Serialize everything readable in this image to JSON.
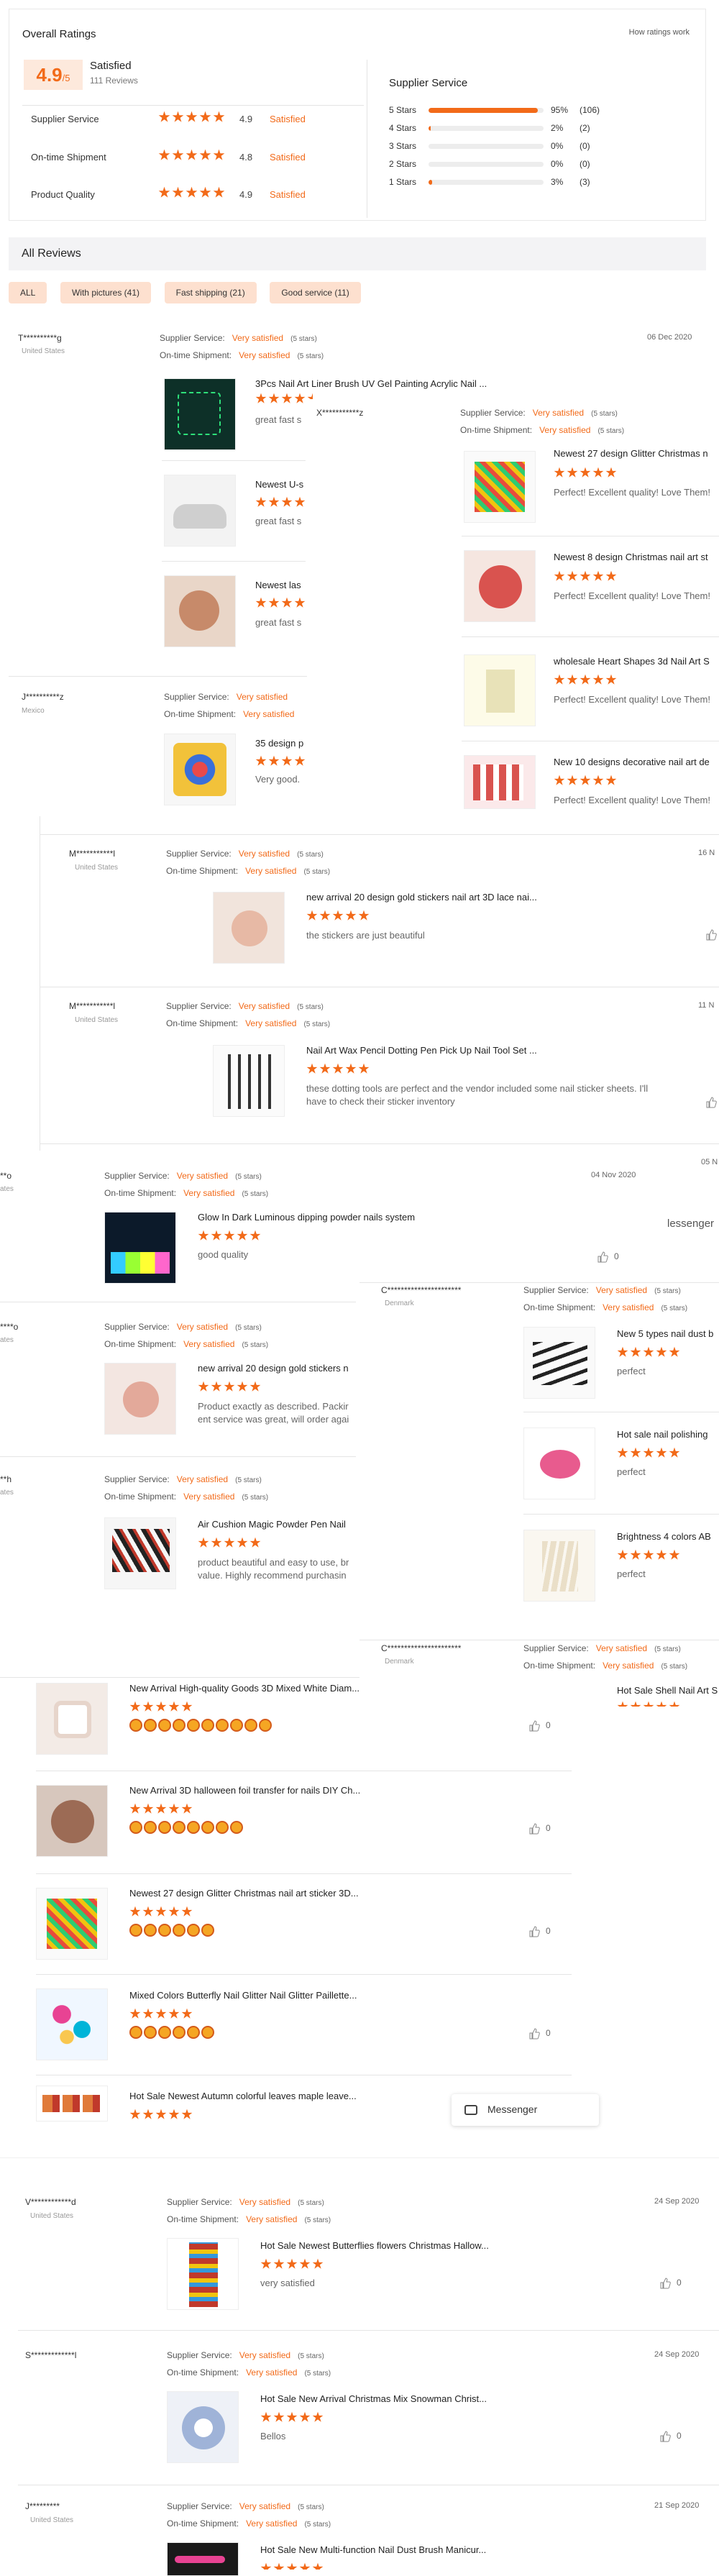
{
  "overall": {
    "title": "Overall Ratings",
    "how_link": "How ratings work",
    "score": "4.9",
    "score_suffix": "/5",
    "label": "Satisfied",
    "count": "111 Reviews",
    "metrics": [
      {
        "name": "Supplier Service",
        "score": "4.9",
        "level": "Satisfied"
      },
      {
        "name": "On-time Shipment",
        "score": "4.8",
        "level": "Satisfied"
      },
      {
        "name": "Product Quality",
        "score": "4.9",
        "level": "Satisfied"
      }
    ],
    "supplier_service_title": "Supplier Service",
    "distribution": [
      {
        "label": "5 Stars",
        "pct": "95%",
        "count": "(106)",
        "fraction": 0.95
      },
      {
        "label": "4 Stars",
        "pct": "2%",
        "count": "(2)",
        "fraction": 0.02
      },
      {
        "label": "3 Stars",
        "pct": "0%",
        "count": "(0)",
        "fraction": 0
      },
      {
        "label": "2 Stars",
        "pct": "0%",
        "count": "(0)",
        "fraction": 0
      },
      {
        "label": "1 Stars",
        "pct": "3%",
        "count": "(3)",
        "fraction": 0.03
      }
    ]
  },
  "all_reviews": {
    "title": "All Reviews",
    "filters": [
      "ALL",
      "With pictures (41)",
      "Fast shipping (21)",
      "Good service (11)"
    ]
  },
  "labels": {
    "supplier_service": "Supplier Service:",
    "on_time": "On-time Shipment:",
    "very_satisfied": "Very satisfied",
    "five_stars": "(5 stars)"
  },
  "reviews_a": {
    "r1": {
      "name": "T**********g",
      "country": "United States",
      "date": "06 Dec 2020",
      "items": [
        {
          "product": "3Pcs Nail Art Liner Brush UV Gel Painting Acrylic Nail ...",
          "text": "great fast s"
        },
        {
          "product": "Newest U-s",
          "text": "great fast s"
        },
        {
          "product": "Newest las",
          "text": "great fast s"
        }
      ]
    },
    "r2": {
      "name": "J**********z",
      "country": "Mexico",
      "items": [
        {
          "product": "35 design p",
          "text": "Very good."
        }
      ]
    },
    "r_overlay": {
      "name": "X***********z",
      "items": [
        {
          "product": "Newest 27 design Glitter Christmas n",
          "text": "Perfect! Excellent quality! Love Them!"
        },
        {
          "product": "Newest 8 design Christmas nail art st",
          "text": "Perfect! Excellent quality! Love Them!"
        },
        {
          "product": "wholesale Heart Shapes 3d Nail Art S",
          "text": "Perfect! Excellent quality! Love Them!"
        },
        {
          "product": "New 10 designs decorative nail art de",
          "text": "Perfect! Excellent quality! Love Them!"
        }
      ]
    },
    "r3": {
      "name": "M***********l",
      "country": "United States",
      "date": "16 N",
      "product": "new arrival 20 design gold stickers nail art 3D lace nai...",
      "text": "the stickers are just beautiful"
    },
    "r4": {
      "name": "M***********l",
      "country": "United States",
      "date": "11 N",
      "product": "Nail Art Wax Pencil Dotting Pen Pick Up Nail Tool Set ...",
      "text": "these dotting tools are perfect and the vendor included some nail sticker sheets. I'll have to check their sticker inventory"
    }
  },
  "reviews_b": {
    "r5": {
      "name": "**o",
      "country": "ates",
      "date": "04 Nov 2020",
      "date2": "05 N",
      "product": "Glow In Dark Luminous dipping powder nails system",
      "text": "good quality",
      "likes": "0"
    },
    "messenger_partial": "lessenger",
    "r6": {
      "name": "****o",
      "country": "ates",
      "product": "new arrival 20 design gold stickers n",
      "text": "Product exactly as described. Packir ent service was great, will order agai"
    },
    "r7": {
      "name": "**h",
      "country": "ates",
      "product": "Air Cushion Magic Powder Pen Nail",
      "text": "product beautiful and easy to use, br value. Highly recommend purchasin"
    },
    "r8": {
      "name": "C**********************",
      "country": "Denmark",
      "items": [
        {
          "product": "New 5 types nail dust b",
          "text": "perfect"
        },
        {
          "product": "Hot sale nail polishing",
          "text": "perfect"
        },
        {
          "product": "Brightness 4 colors AB",
          "text": "perfect"
        }
      ]
    },
    "r9": {
      "name": "C**********************",
      "country": "Denmark",
      "product": "Hot Sale Shell Nail Art S"
    }
  },
  "reviews_c": {
    "items": [
      {
        "product": "New Arrival High-quality Goods 3D Mixed White Diam...",
        "likes": "0",
        "emojis": 10
      },
      {
        "product": "New Arrival 3D halloween foil transfer for nails DIY Ch...",
        "likes": "0",
        "emojis": 8
      },
      {
        "product": "Newest 27 design Glitter Christmas nail art sticker 3D...",
        "likes": "0",
        "emojis": 6
      },
      {
        "product": "Mixed Colors Butterfly Nail Glitter Nail Glitter Paillette...",
        "likes": "0",
        "emojis": 6
      },
      {
        "product": "Hot Sale Newest Autumn colorful leaves maple leave..."
      }
    ],
    "messenger": "Messenger"
  },
  "reviews_d": [
    {
      "name": "V************d",
      "country": "United States",
      "date": "24 Sep 2020",
      "product": "Hot Sale Newest Butterflies flowers Christmas Hallow...",
      "text": "very satisfied",
      "likes": "0"
    },
    {
      "name": "S*************l",
      "country": "",
      "date": "24 Sep 2020",
      "product": "Hot Sale New Arrival Christmas Mix Snowman Christ...",
      "text": "Bellos",
      "likes": "0"
    },
    {
      "name": "J*********",
      "country": "United States",
      "date": "21 Sep 2020",
      "product": "Hot Sale New Multi-function Nail Dust Brush Manicur..."
    }
  ]
}
